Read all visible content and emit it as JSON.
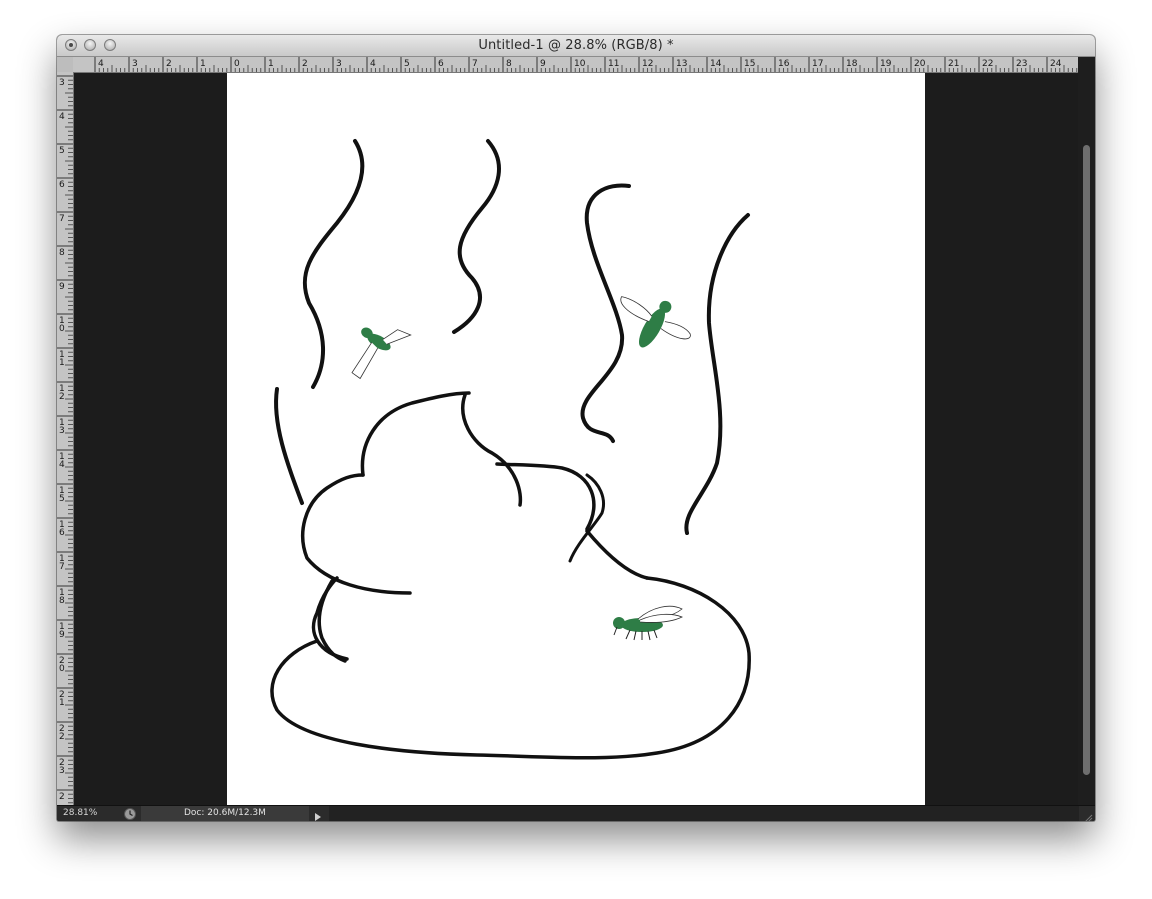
{
  "window": {
    "title": "Untitled-1 @ 28.8% (RGB/8) *"
  },
  "titlebar_buttons": [
    {
      "name": "close-button",
      "icon": "close-icon"
    },
    {
      "name": "minimize-button",
      "icon": "minimize-icon"
    },
    {
      "name": "zoom-button",
      "icon": "zoom-icon"
    }
  ],
  "ruler_horizontal": {
    "labels": [
      "4",
      "3",
      "2",
      "1",
      "0",
      "1",
      "2",
      "3",
      "4",
      "5",
      "6",
      "7",
      "8",
      "9",
      "10",
      "11",
      "12",
      "13",
      "14",
      "15",
      "16",
      "17",
      "18",
      "19",
      "20",
      "21",
      "22",
      "23",
      "24"
    ]
  },
  "ruler_vertical": {
    "labels": [
      "3",
      "4",
      "5",
      "6",
      "7",
      "8",
      "9",
      "10",
      "11",
      "12",
      "13",
      "14",
      "15",
      "16",
      "17",
      "18",
      "19",
      "20",
      "21",
      "22",
      "23",
      "2"
    ]
  },
  "statusbar": {
    "zoom": "28.81%",
    "doc_info": "Doc: 20.6M/12.3M",
    "status_icon": "timer-icon",
    "arrow_icon": "triangle-right-icon"
  },
  "colors": {
    "canvas_background": "#1c1c1c",
    "artboard": "#ffffff",
    "ink": "#111111",
    "fly_green": "#2e7d46"
  }
}
